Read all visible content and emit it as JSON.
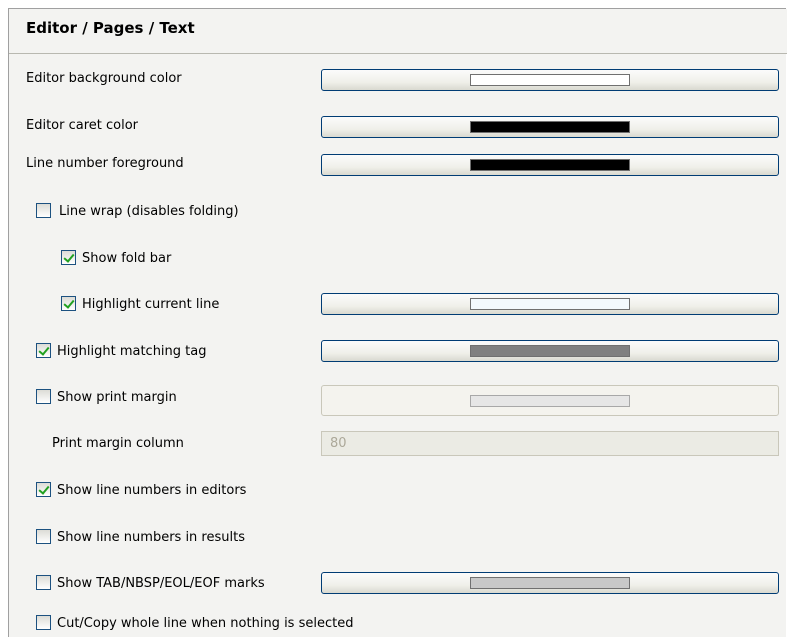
{
  "header": {
    "title": "Editor / Pages / Text"
  },
  "rows": {
    "bg_color": {
      "label": "Editor background color",
      "swatch": "#ffffff"
    },
    "caret_color": {
      "label": "Editor caret color",
      "swatch": "#000000"
    },
    "line_number_fg": {
      "label": "Line number foreground",
      "swatch": "#000000"
    },
    "line_wrap": {
      "label": "Line wrap (disables folding)",
      "checked": false
    },
    "show_fold_bar": {
      "label": "Show fold bar",
      "checked": true
    },
    "highlight_current_line": {
      "label": "Highlight current line",
      "checked": true,
      "swatch": "#f3f9fd"
    },
    "highlight_matching_tag": {
      "label": "Highlight matching tag",
      "checked": true,
      "swatch": "#808080"
    },
    "show_print_margin": {
      "label": "Show print margin",
      "checked": false,
      "swatch": "#e6e6e6"
    },
    "print_margin_column": {
      "label": "Print margin column",
      "value": "80"
    },
    "show_line_numbers_editors": {
      "label": "Show line numbers in editors",
      "checked": true
    },
    "show_line_numbers_results": {
      "label": "Show line numbers in results",
      "checked": false
    },
    "show_marks": {
      "label": "Show TAB/NBSP/EOL/EOF marks",
      "checked": false,
      "swatch": "#c8c8c8"
    },
    "cut_copy_whole_line": {
      "label": "Cut/Copy whole line when nothing is selected",
      "checked": false
    }
  }
}
